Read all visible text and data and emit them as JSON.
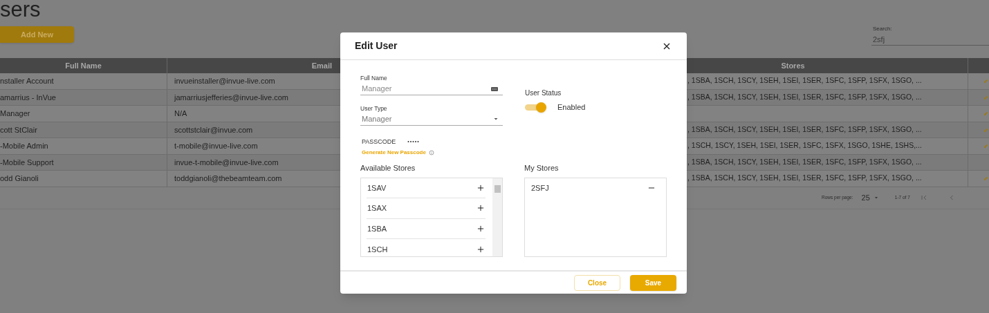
{
  "page": {
    "title": "sers",
    "add_button": "Add New",
    "search": {
      "label": "Search:",
      "value": "2sfj"
    }
  },
  "table": {
    "columns": [
      "Full Name",
      "Email",
      "Stores"
    ],
    "rows": [
      {
        "full_name": "nstaller Account",
        "email": "invueinstaller@invue-live.com",
        "stores": ", 1SBA, 1SCH, 1SCY, 1SEH, 1SEI, 1SER, 1SFC, 1SFP, 1SFX, 1SGO, ...",
        "edit_icon": true
      },
      {
        "full_name": "amarrius - InVue",
        "email": "jamarriusjefferies@invue-live.com",
        "stores": ", 1SBA, 1SCH, 1SCY, 1SEH, 1SEI, 1SER, 1SFC, 1SFP, 1SFX, 1SGO, ...",
        "edit_icon": true
      },
      {
        "full_name": "Manager",
        "email": "N/A",
        "stores": "",
        "edit_icon": true
      },
      {
        "full_name": "cott StClair",
        "email": "scottstclair@invue.com",
        "stores": ", 1SBA, 1SCH, 1SCY, 1SEH, 1SEI, 1SER, 1SFC, 1SFP, 1SFX, 1SGO, ...",
        "edit_icon": true
      },
      {
        "full_name": "-Mobile Admin",
        "email": "t-mobile@invue-live.com",
        "stores": ", 1SCH, 1SCY, 1SEH, 1SEI, 1SER, 1SFC, 1SFX, 1SGO, 1SHE, 1SHS,...",
        "edit_icon": true
      },
      {
        "full_name": "-Mobile Support",
        "email": "invue-t-mobile@invue-live.com",
        "stores": ", 1SBA, 1SCH, 1SCY, 1SEH, 1SEI, 1SER, 1SFC, 1SFP, 1SFX, 1SGO, ...",
        "edit_icon": false
      },
      {
        "full_name": "odd Gianoli",
        "email": "toddgianoli@thebeamteam.com",
        "stores": ", 1SBA, 1SCH, 1SCY, 1SEH, 1SEI, 1SER, 1SFC, 1SFP, 1SFX, 1SGO, ...",
        "edit_icon": true
      }
    ],
    "pagination": {
      "rows_label": "Rows per page:",
      "rows_value": "25",
      "range": "1-7 of 7"
    }
  },
  "dialog": {
    "title": "Edit User",
    "full_name": {
      "label": "Full Name",
      "placeholder": "Manager"
    },
    "user_type": {
      "label": "User Type",
      "value": "Manager"
    },
    "user_status": {
      "label": "User Status",
      "on": true,
      "text": "Enabled"
    },
    "passcode": {
      "label": "PASSCODE",
      "value": "•••••",
      "generate_link": "Generate New Passcode"
    },
    "available_stores": {
      "title": "Available Stores",
      "items": [
        "1SAV",
        "1SAX",
        "1SBA",
        "1SCH"
      ]
    },
    "my_stores": {
      "title": "My Stores",
      "items": [
        "2SFJ"
      ]
    },
    "buttons": [
      "Close",
      "Save"
    ]
  }
}
